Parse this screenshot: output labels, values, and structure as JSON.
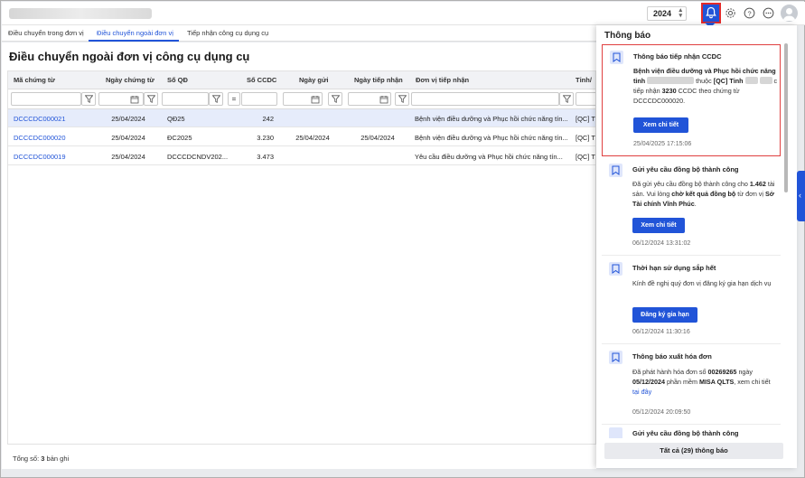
{
  "header": {
    "year": "2024",
    "icons": [
      "bell-icon",
      "gear-icon",
      "help-icon",
      "more-icon",
      "user-icon"
    ]
  },
  "tabs": [
    {
      "label": "Điều chuyển trong đơn vị",
      "active": false
    },
    {
      "label": "Điều chuyển ngoài đơn vị",
      "active": true
    },
    {
      "label": "Tiếp nhận công cụ dụng cụ",
      "active": false
    }
  ],
  "page": {
    "title": "Điều chuyển ngoài đơn vị công cụ dụng cụ"
  },
  "grid": {
    "columns": [
      "Mã chứng từ",
      "Ngày chứng từ",
      "Số QĐ",
      "Số CCDC",
      "Ngày gửi",
      "Ngày tiếp nhận",
      "Đơn vị tiếp nhận",
      "Tỉnh/"
    ],
    "filter_operator": "=",
    "rows": [
      {
        "code": "DCCCDC000021",
        "date": "25/04/2024",
        "decision": "QĐ25",
        "qty": "242",
        "sent": "",
        "received": "",
        "unit": "Bệnh viện điều dưỡng và Phục hồi chức năng tín...",
        "province": "[QC] T"
      },
      {
        "code": "DCCCDC000020",
        "date": "25/04/2024",
        "decision": "ĐC2025",
        "qty": "3.230",
        "sent": "25/04/2024",
        "received": "25/04/2024",
        "unit": "Bệnh viện điều dưỡng và Phục hồi chức năng tín...",
        "province": "[QC] T"
      },
      {
        "code": "DCCCDC000019",
        "date": "25/04/2024",
        "decision": "DCCCDCNDV202...",
        "qty": "3.473",
        "sent": "",
        "received": "",
        "unit": "Yêu cầu điều dưỡng và Phục hồi chức năng tín...",
        "province": "[QC] T"
      }
    ],
    "footer_label": "Tổng số:",
    "footer_count": "3",
    "footer_suffix": "bản ghi"
  },
  "notifications": {
    "title": "Thông báo",
    "items": [
      {
        "title": "Thông báo tiếp nhận CCDC",
        "body_a": "Bệnh viện điều dưỡng và Phục hồi chức năng tỉnh",
        "body_b": "thuộc",
        "body_c": "[QC] Tỉnh",
        "body_d": "c tiếp nhận",
        "body_e": "3230",
        "body_f": "CCDC theo chứng từ DCCCDC000020.",
        "button": "Xem chi tiết",
        "time": "25/04/2025 17:15:06"
      },
      {
        "title": "Gửi yêu cầu đồng bộ thành công",
        "body_a": "Đã gửi yêu cầu đồng bộ thành công cho",
        "body_b": "1.462",
        "body_c": "tài sản. Vui lòng",
        "body_d": "chờ kết quả đồng bộ",
        "body_e": "từ đơn vị",
        "body_f": "Sở Tài chính Vĩnh Phúc",
        "button": "Xem chi tiết",
        "time": "06/12/2024 13:31:02"
      },
      {
        "title": "Thời hạn sử dụng sắp hết",
        "body": "Kính đề nghị quý đơn vị đăng ký gia hạn dịch vụ",
        "button": "Đăng ký gia hạn",
        "time": "06/12/2024 11:30:16"
      },
      {
        "title": "Thông báo xuất hóa đơn",
        "body_a": "Đã phát hành hóa đơn số",
        "body_b": "00269265",
        "body_c": "ngày",
        "body_d": "05/12/2024",
        "body_e": "phần mềm",
        "body_f": "MISA QLTS",
        "body_g": ", xem chi tiết",
        "body_link": "tại đây",
        "time": "05/12/2024 20:09:50"
      },
      {
        "title": "Gửi yêu cầu đồng bộ thành công"
      }
    ],
    "all_button": "Tất cả (29) thông báo"
  }
}
